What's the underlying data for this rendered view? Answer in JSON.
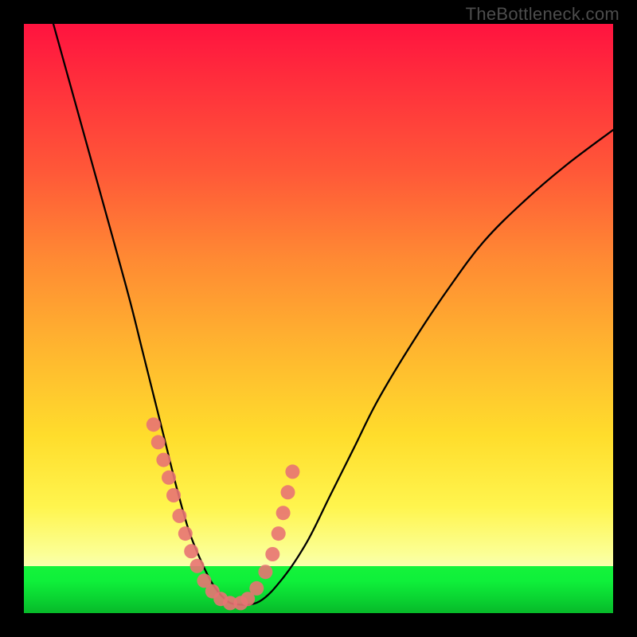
{
  "watermark": "TheBottleneck.com",
  "chart_data": {
    "type": "line",
    "title": "",
    "xlabel": "",
    "ylabel": "",
    "xlim": [
      0,
      100
    ],
    "ylim": [
      0,
      100
    ],
    "grid": false,
    "note": "No numeric axis ticks or labels are visible; curve and dot coordinates below are expressed as percentages of the plot area width/height (0,0 = top-left, 100,100 = bottom-right) estimated from pixels.",
    "series": [
      {
        "name": "bottleneck-curve",
        "type": "line",
        "x": [
          5,
          10,
          15,
          18,
          20,
          22,
          24,
          26,
          28,
          30,
          32,
          34,
          36,
          40,
          44,
          48,
          52,
          56,
          60,
          66,
          72,
          78,
          85,
          92,
          100
        ],
        "y": [
          0,
          18,
          36,
          47,
          55,
          63,
          71,
          79,
          86,
          91,
          95,
          97.5,
          98.5,
          98,
          94,
          88,
          80,
          72,
          64,
          54,
          45,
          37,
          30,
          24,
          18
        ]
      },
      {
        "name": "highlight-dots",
        "type": "scatter",
        "x": [
          22.0,
          22.8,
          23.7,
          24.6,
          25.4,
          26.4,
          27.4,
          28.4,
          29.4,
          30.6,
          32.0,
          33.4,
          35.0,
          36.8,
          38.0,
          39.5,
          41.0,
          42.2,
          43.2,
          44.0,
          44.8,
          45.6
        ],
        "y": [
          68.0,
          71.0,
          74.0,
          77.0,
          80.0,
          83.5,
          86.5,
          89.5,
          92.0,
          94.5,
          96.3,
          97.6,
          98.3,
          98.3,
          97.6,
          95.8,
          93.0,
          90.0,
          86.5,
          83.0,
          79.5,
          76.0
        ]
      }
    ]
  }
}
